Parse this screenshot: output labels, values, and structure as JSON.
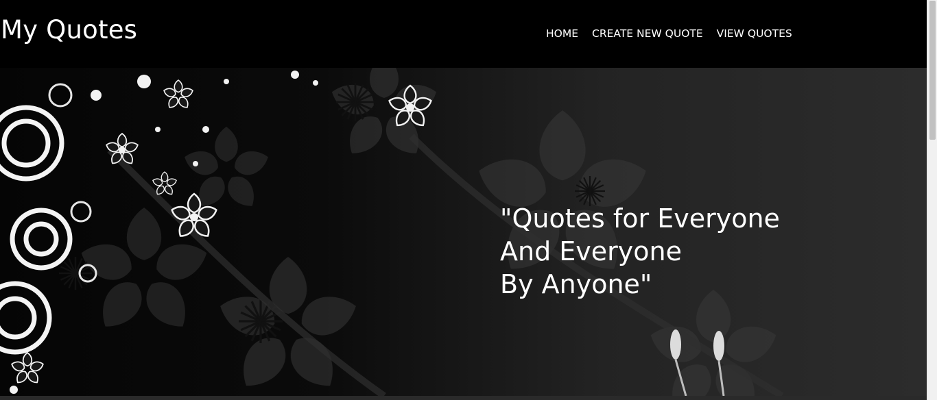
{
  "navbar": {
    "brand": "My Quotes",
    "links": [
      {
        "label": "HOME"
      },
      {
        "label": "CREATE NEW QUOTE"
      },
      {
        "label": "VIEW QUOTES"
      }
    ]
  },
  "hero": {
    "quote_lines": [
      "\"Quotes for Everyone",
      "And Everyone",
      "By Anyone\""
    ]
  },
  "colors": {
    "navbar_bg": "#000000",
    "text": "#ffffff",
    "scrollbar_track": "#f1f1f1",
    "scrollbar_thumb": "#c1c1c1"
  }
}
